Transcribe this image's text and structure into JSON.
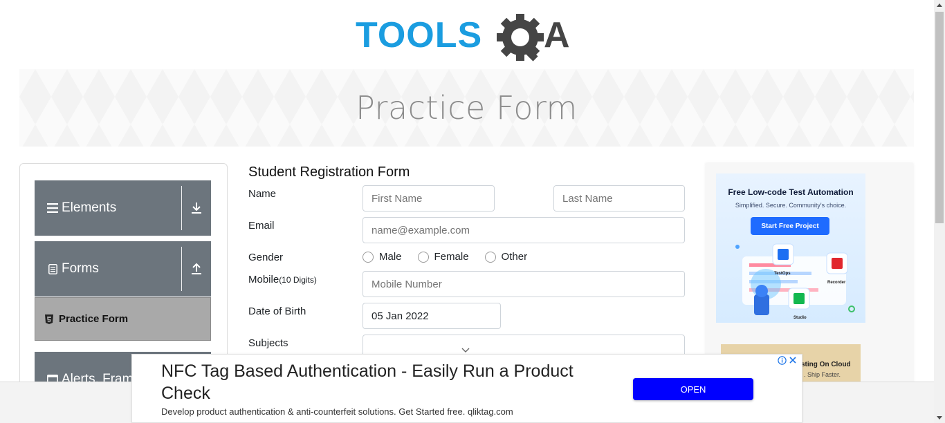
{
  "header": {
    "logo_text_left": "TOOLS",
    "logo_text_right": "A",
    "colors": {
      "logo_blue": "#1b9de0",
      "logo_dark": "#454545"
    }
  },
  "banner": {
    "title": "Practice Form"
  },
  "sidebar": {
    "groups": [
      {
        "label": "Elements",
        "icon": "hamburger-icon",
        "toggle_icon": "download-arrow-icon"
      },
      {
        "label": "Forms",
        "icon": "document-icon",
        "toggle_icon": "upload-arrow-icon"
      },
      {
        "label": "Alerts, Frame & Windows",
        "icon": "window-icon"
      }
    ],
    "active_item": {
      "label": "Practice Form",
      "icon": "html5-icon"
    },
    "colors": {
      "group_bg": "#6c757d",
      "active_bg": "#a9a9a9"
    }
  },
  "form": {
    "title": "Student Registration Form",
    "name_label": "Name",
    "first_name_placeholder": "First Name",
    "last_name_placeholder": "Last Name",
    "email_label": "Email",
    "email_placeholder": "name@example.com",
    "gender_label": "Gender",
    "gender_options": [
      "Male",
      "Female",
      "Other"
    ],
    "mobile_label": "Mobile",
    "mobile_hint": "(10 Digits)",
    "mobile_placeholder": "Mobile Number",
    "dob_label": "Date of Birth",
    "dob_value": "05 Jan 2022",
    "subjects_label": "Subjects"
  },
  "right_ad": {
    "headline": "Free Low-code Test Automation",
    "subline": "Simplified. Secure. Community's choice.",
    "button_label": "Start Free Project",
    "product_labels": [
      "TestOps",
      "Recorder",
      "Studio"
    ],
    "second_ad_line1": "sting On Cloud",
    "second_ad_line2": ". Ship Faster."
  },
  "bottom_ad": {
    "title": "NFC Tag Based Authentication - Easily Run a Product Check",
    "description": "Develop product authentication & anti-counterfeit solutions. Get Started free. qliktag.com",
    "open_label": "OPEN",
    "info_icon": "info-icon",
    "close_icon": "close-icon",
    "colors": {
      "open_button": "#0000ff"
    }
  }
}
